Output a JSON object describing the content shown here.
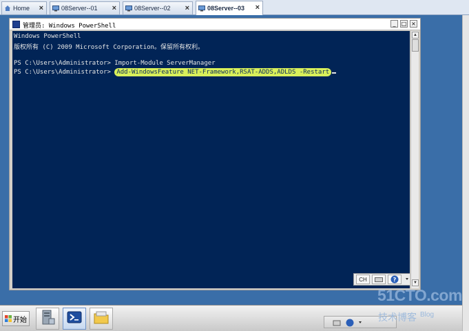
{
  "tabs": [
    {
      "label": "Home",
      "active": false
    },
    {
      "label": "08Server--01",
      "active": false
    },
    {
      "label": "08Server--02",
      "active": false
    },
    {
      "label": "08Server--03",
      "active": true
    }
  ],
  "window": {
    "title": "管理员: Windows PowerShell",
    "minimize": "_",
    "maximize": "□",
    "close": "×"
  },
  "console": {
    "lines": [
      "Windows PowerShell",
      "版权所有 (C) 2009 Microsoft Corporation。保留所有权利。",
      "",
      "PS C:\\Users\\Administrator> Import-Module ServerManager"
    ],
    "prompt": "PS C:\\Users\\Administrator> ",
    "command": "Add-WindowsFeature NET-Framework,RSAT-ADDS,ADLDS -Restart"
  },
  "language_bar": {
    "lang": "CH",
    "help": "?"
  },
  "taskbar": {
    "start_label": "开始",
    "icons": [
      "server-manager-icon",
      "powershell-icon",
      "folder-icon"
    ]
  },
  "watermark": {
    "site": "51CTO.com",
    "tagline": "技术博客",
    "sub": "Blog"
  },
  "colors": {
    "console_bg": "#012456",
    "desktop_bg": "#3a6ea8",
    "highlight": "#d9f05a"
  }
}
